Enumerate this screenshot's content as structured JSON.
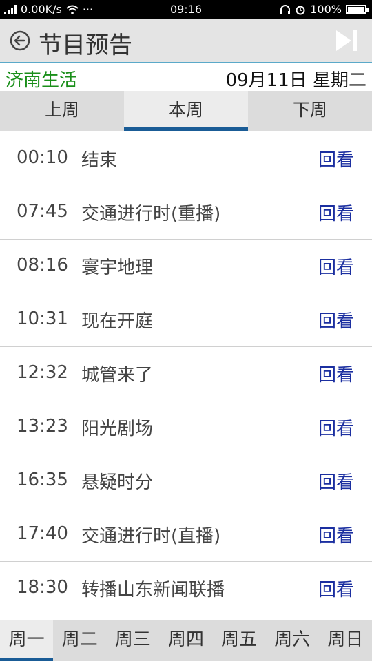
{
  "status_bar": {
    "network": "2G",
    "speed": "0.00K/s",
    "more": "···",
    "time": "09:16",
    "battery": "100%",
    "battery_level": 1.0
  },
  "header": {
    "title": "节目预告",
    "back_icon": "back-circle-icon",
    "next_icon": "skip-next-icon"
  },
  "info": {
    "channel": "济南生活",
    "date": "09月11日  星期二"
  },
  "week_tabs": [
    {
      "label": "上周"
    },
    {
      "label": "本周",
      "active": true
    },
    {
      "label": "下周"
    }
  ],
  "programs": [
    {
      "time": "00:10",
      "title": "结束",
      "action": "回看"
    },
    {
      "time": "07:45",
      "title": "交通进行时(重播)",
      "action": "回看"
    },
    {
      "time": "08:16",
      "title": "寰宇地理",
      "action": "回看"
    },
    {
      "time": "10:31",
      "title": "现在开庭",
      "action": "回看"
    },
    {
      "time": "12:32",
      "title": "城管来了",
      "action": "回看"
    },
    {
      "time": "13:23",
      "title": "阳光剧场",
      "action": "回看"
    },
    {
      "time": "16:35",
      "title": "悬疑时分",
      "action": "回看"
    },
    {
      "time": "17:40",
      "title": "交通进行时(直播)",
      "action": "回看"
    },
    {
      "time": "18:30",
      "title": "转播山东新闻联播",
      "action": "回看"
    }
  ],
  "day_tabs": [
    {
      "label": "周一",
      "active": true
    },
    {
      "label": "周二"
    },
    {
      "label": "周三"
    },
    {
      "label": "周四"
    },
    {
      "label": "周五"
    },
    {
      "label": "周六"
    },
    {
      "label": "周日"
    }
  ],
  "colors": {
    "channel": "#1a8f1a",
    "replay": "#1b2fa0",
    "tab_indicator": "#1a5c96",
    "header_bg": "#e4e4e4"
  }
}
